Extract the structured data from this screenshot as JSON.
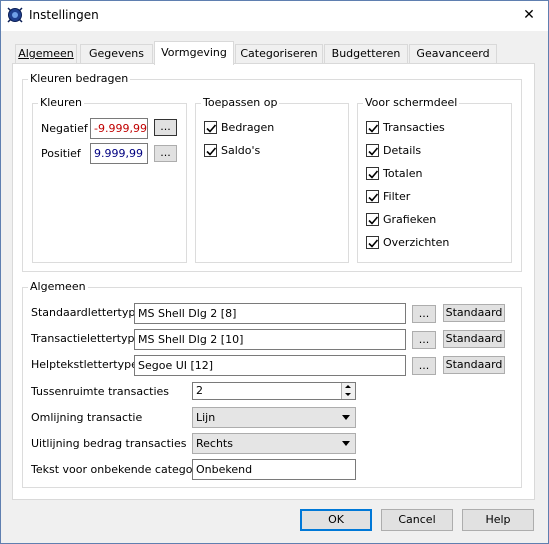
{
  "window": {
    "title": "Instellingen",
    "close": "✕"
  },
  "tabs": [
    {
      "label": "Algemeen"
    },
    {
      "label": "Gegevens"
    },
    {
      "label": "Vormgeving"
    },
    {
      "label": "Categoriseren"
    },
    {
      "label": "Budgetteren"
    },
    {
      "label": "Geavanceerd"
    }
  ],
  "colors_section": {
    "legend": "Kleuren bedragen",
    "kleuren": {
      "legend": "Kleuren",
      "negative_label": "Negatief",
      "negative_value": "-9.999,99",
      "negative_color": "#c00000",
      "positive_label": "Positief",
      "positive_value": "9.999,99",
      "positive_color": "#000080",
      "browse": "..."
    },
    "apply_to": {
      "legend": "Toepassen op",
      "items": [
        {
          "label": "Bedragen",
          "checked": true
        },
        {
          "label": "Saldo's",
          "checked": true
        }
      ]
    },
    "screen_part": {
      "legend": "Voor schermdeel",
      "items": [
        {
          "label": "Transacties",
          "checked": true
        },
        {
          "label": "Details",
          "checked": true
        },
        {
          "label": "Totalen",
          "checked": true
        },
        {
          "label": "Filter",
          "checked": true
        },
        {
          "label": "Grafieken",
          "checked": true
        },
        {
          "label": "Overzichten",
          "checked": true
        }
      ]
    }
  },
  "general_section": {
    "legend": "Algemeen",
    "fonts": [
      {
        "label": "Standaardlettertype",
        "value": "MS Shell Dlg 2 [8]"
      },
      {
        "label": "Transactielettertype",
        "value": "MS Shell Dlg 2 [10]"
      },
      {
        "label": "Helptekstlettertype",
        "value": "Segoe UI [12]"
      }
    ],
    "browse": "...",
    "default_button": "Standaard",
    "spacing": {
      "label": "Tussenruimte transacties",
      "value": "2"
    },
    "outline": {
      "label": "Omlijning transactie",
      "value": "Lijn"
    },
    "alignment": {
      "label": "Uitlijning bedrag transacties",
      "value": "Rechts"
    },
    "unknown_category": {
      "label": "Tekst voor onbekende categorie",
      "value": "Onbekend"
    }
  },
  "footer": {
    "ok": "OK",
    "cancel": "Cancel",
    "help": "Help"
  }
}
